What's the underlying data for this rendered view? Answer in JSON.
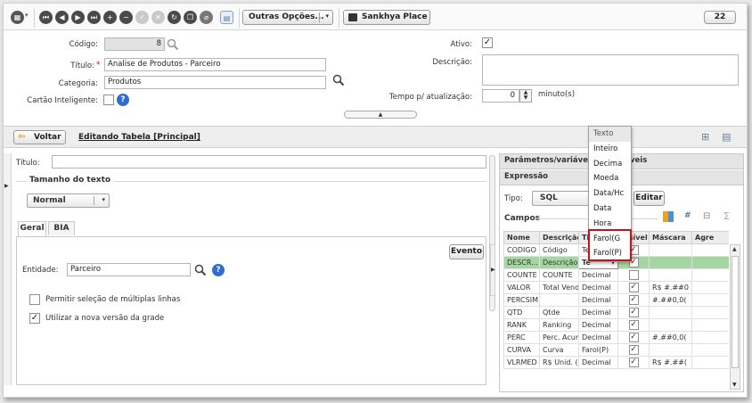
{
  "toolbar": {
    "outras_opcoes": "Outras Opções...",
    "sankhya_place": "Sankhya Place",
    "badge": "22"
  },
  "form": {
    "codigo_label": "Código:",
    "codigo_value": "8",
    "titulo_label": "Título:",
    "titulo_required": "*",
    "titulo_value": "Analise de Produtos - Parceiro",
    "categoria_label": "Categoria:",
    "categoria_value": "Produtos",
    "cartao_label": "Cartão Inteligente:",
    "ativo_label": "Ativo:",
    "descricao_label": "Descrição:",
    "tempo_label": "Tempo p/ atualização:",
    "tempo_value": "0",
    "tempo_unit": "minuto(s)"
  },
  "subbar": {
    "voltar": "Voltar",
    "editing": "Editando Tabela [Principal]"
  },
  "left": {
    "titulo_label": "Título:",
    "tamanho_label": "Tamanho do texto",
    "tamanho_value": "Normal",
    "tabs": [
      "Geral",
      "BIA"
    ],
    "evento_button": "Evento",
    "entidade_label": "Entidade:",
    "entidade_value": "Parceiro",
    "opt1": "Permitir seleção de múltiplas linhas",
    "opt2": "Utilizar a nova versão da grade"
  },
  "right": {
    "param_header": "Parâmetros/variáveis",
    "param_header_tail": "veis",
    "expressao_header": "Expressão",
    "tipo_label": "Tipo:",
    "tipo_value": "SQL",
    "editar_button": "Editar",
    "campos_label": "Campos",
    "columns": [
      "Nome",
      "Descrição",
      "Tipo",
      "Visível",
      "Máscara",
      "Agre"
    ],
    "rows": [
      {
        "nome": "CODIGO",
        "descricao": "Código",
        "tipo": "Texto",
        "visivel": true,
        "mascara": ""
      },
      {
        "nome": "DESCR...",
        "descricao": "Descrição",
        "tipo": "Te",
        "visivel": true,
        "mascara": ""
      },
      {
        "nome": "COUNTE",
        "descricao": "COUNTE",
        "tipo": "Decimal",
        "visivel": false,
        "mascara": ""
      },
      {
        "nome": "VALOR",
        "descricao": "Total Vendi",
        "tipo": "Decimal",
        "visivel": true,
        "mascara": "R$ #.##0"
      },
      {
        "nome": "PERCSIM",
        "descricao": "",
        "tipo": "Decimal",
        "visivel": true,
        "mascara": "#.##0,0("
      },
      {
        "nome": "QTD",
        "descricao": "Qtde",
        "tipo": "Decimal",
        "visivel": true,
        "mascara": ""
      },
      {
        "nome": "RANK",
        "descricao": "Ranking",
        "tipo": "Decimal",
        "visivel": true,
        "mascara": ""
      },
      {
        "nome": "PERC",
        "descricao": "Perc. Acum",
        "tipo": "Decimal",
        "visivel": true,
        "mascara": "#.##0,0("
      },
      {
        "nome": "CURVA",
        "descricao": "Curva",
        "tipo": "Farol(P)",
        "visivel": true,
        "mascara": ""
      },
      {
        "nome": "VLRMED",
        "descricao": "R$ Unid. (I",
        "tipo": "Decimal",
        "visivel": true,
        "mascara": "R$ #.##("
      }
    ],
    "dropdown": [
      "Texto",
      "Inteiro",
      "Decima",
      "Moeda",
      "Data/Hc",
      "Data",
      "Hora",
      "Farol(G",
      "Farol(P)"
    ]
  },
  "colors": {
    "selected_row": "#a5d6a1",
    "highlight_box": "#d01010",
    "hint_icon": "#2f6ed0"
  }
}
